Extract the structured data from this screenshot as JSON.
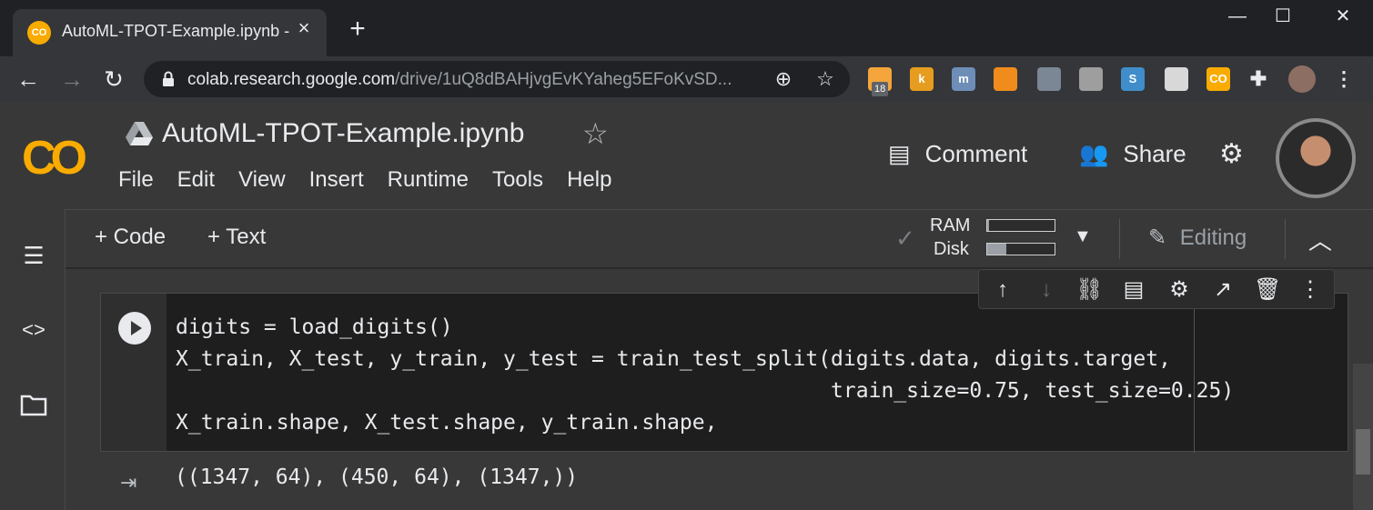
{
  "browser": {
    "tab_title": "AutoML-TPOT-Example.ipynb - C",
    "tab_favicon_text": "CO",
    "url_host": "colab.research.google.com",
    "url_path": "/drive/1uQ8dBAHjvgEvKYaheg5EFoKvSD...",
    "extension_badge": "18",
    "extensions": [
      {
        "name": "extension-orange-icon",
        "label": "",
        "color": "#f4a53b"
      },
      {
        "name": "extension-k-icon",
        "label": "k",
        "color": "#e69d1f"
      },
      {
        "name": "extension-m-icon",
        "label": "m",
        "color": "#6e8eb8"
      },
      {
        "name": "extension-shield-icon",
        "label": "",
        "color": "#f08c1c"
      },
      {
        "name": "extension-graduation-icon",
        "label": "",
        "color": "#7b8794"
      },
      {
        "name": "extension-puzzle-dark-icon",
        "label": "",
        "color": "#9e9e9e"
      },
      {
        "name": "extension-s-icon",
        "label": "S",
        "color": "#3f8ecb"
      },
      {
        "name": "extension-doc-icon",
        "label": "",
        "color": "#d8d8d8"
      },
      {
        "name": "extension-colab-icon",
        "label": "CO",
        "color": "#f9ab00"
      }
    ]
  },
  "header": {
    "logo": "CO",
    "notebook_title": "AutoML-TPOT-Example.ipynb",
    "menu": [
      "File",
      "Edit",
      "View",
      "Insert",
      "Runtime",
      "Tools",
      "Help"
    ],
    "comment_label": "Comment",
    "share_label": "Share"
  },
  "toolbar": {
    "add_code": "+ Code",
    "add_text": "+ Text",
    "ram_label": "RAM",
    "disk_label": "Disk",
    "ram_usage": 0.03,
    "disk_usage": 0.28,
    "editing_label": "Editing"
  },
  "cell": {
    "code_lines": [
      "digits = load_digits()",
      "X_train, X_test, y_train, y_test = train_test_split(digits.data, digits.target,",
      "                                                    train_size=0.75, test_size=0.25)",
      "X_train.shape, X_test.shape, y_train.shape,"
    ],
    "output": "((1347, 64), (450, 64), (1347,))"
  },
  "colors": {
    "accent": "#f9ab00",
    "background": "#383838",
    "cell_background": "#1e1e1e"
  }
}
